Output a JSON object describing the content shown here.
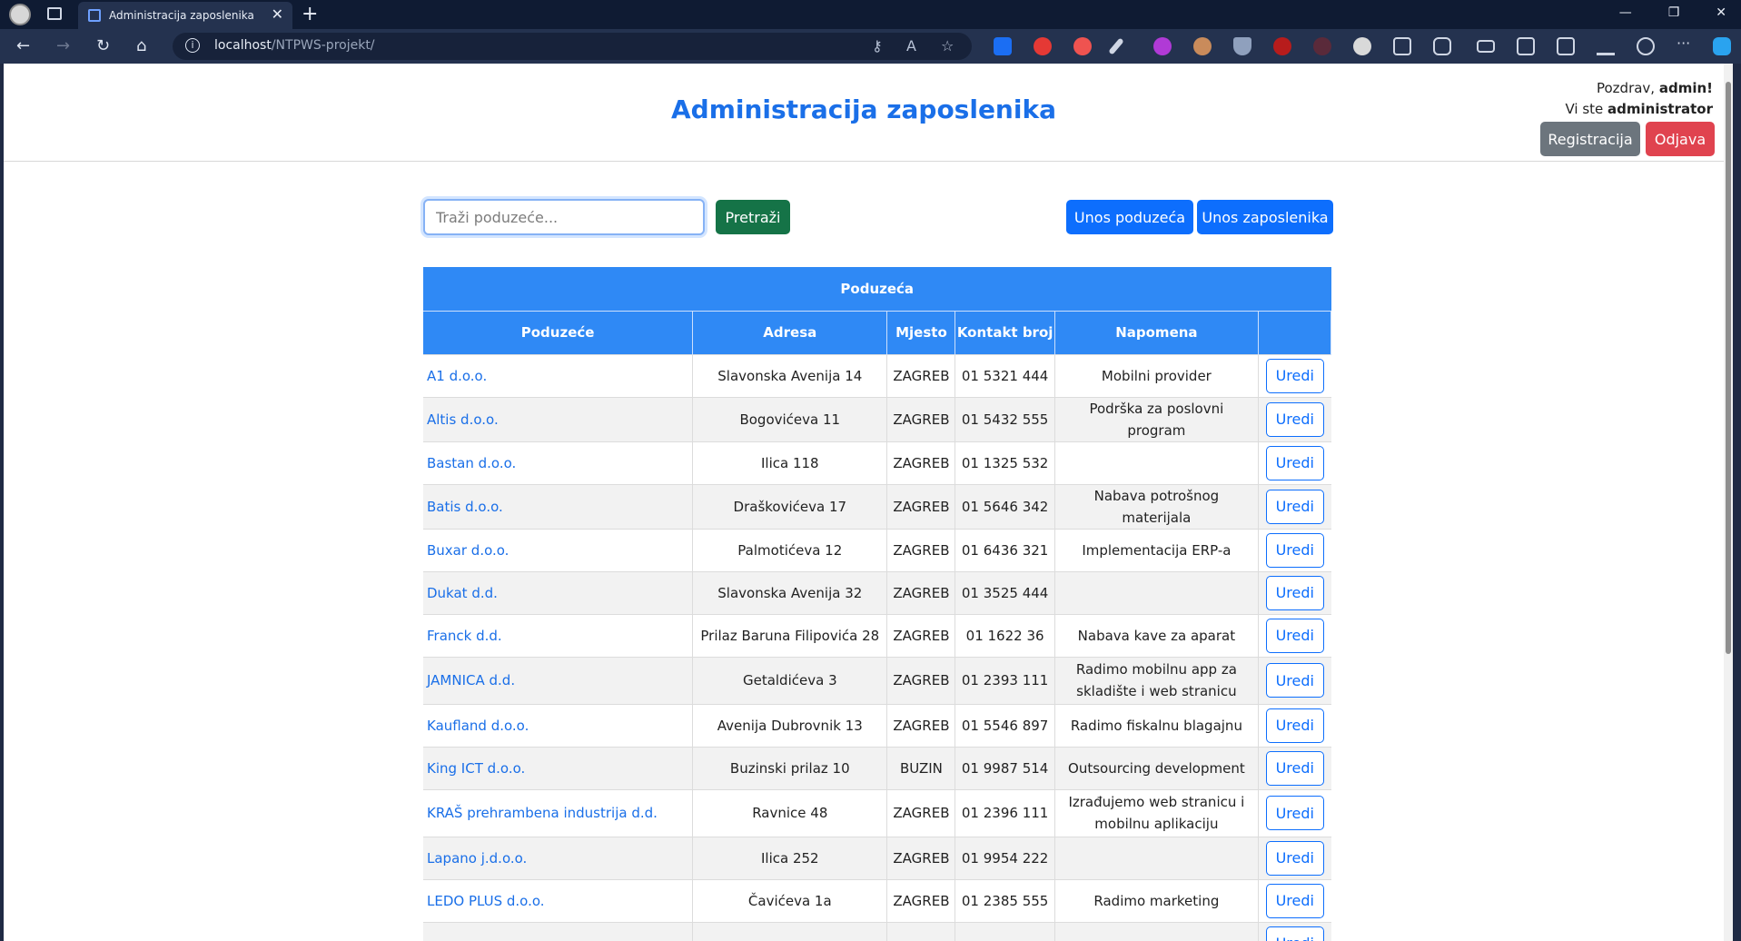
{
  "browser": {
    "tab_title": "Administracija zaposlenika",
    "tab_close": "✕",
    "new_tab": "+",
    "url_host": "localhost",
    "url_path": "/NTPWS-projekt/",
    "win_min": "—",
    "win_max": "❐",
    "win_close": "✕"
  },
  "header": {
    "title": "Administracija zaposlenika",
    "greeting_prefix": "Pozdrav, ",
    "username": "admin!",
    "role_prefix": "Vi ste ",
    "role": "administrator",
    "register_label": "Registracija",
    "logout_label": "Odjava"
  },
  "toolbar": {
    "search_placeholder": "Traži poduzeće...",
    "search_label": "Pretraži",
    "add_company_label": "Unos poduzeća",
    "add_employee_label": "Unos zaposlenika"
  },
  "table": {
    "caption": "Poduzeća",
    "columns": [
      "Poduzeće",
      "Adresa",
      "Mjesto",
      "Kontakt broj",
      "Napomena",
      ""
    ],
    "edit_label": "Uredi",
    "rows": [
      {
        "name": "A1 d.o.o.",
        "address": "Slavonska Avenija 14",
        "city": "ZAGREB",
        "phone": "01 5321 444",
        "note": "Mobilni provider"
      },
      {
        "name": "Altis d.o.o.",
        "address": "Bogovićeva 11",
        "city": "ZAGREB",
        "phone": "01 5432 555",
        "note": "Podrška za poslovni program"
      },
      {
        "name": "Bastan d.o.o.",
        "address": "Ilica 118",
        "city": "ZAGREB",
        "phone": "01 1325 532",
        "note": ""
      },
      {
        "name": "Batis d.o.o.",
        "address": "Draškovićeva 17",
        "city": "ZAGREB",
        "phone": "01 5646 342",
        "note": "Nabava potrošnog materijala"
      },
      {
        "name": "Buxar d.o.o.",
        "address": "Palmotićeva 12",
        "city": "ZAGREB",
        "phone": "01 6436 321",
        "note": "Implementacija ERP-a"
      },
      {
        "name": "Dukat d.d.",
        "address": "Slavonska Avenija 32",
        "city": "ZAGREB",
        "phone": "01 3525 444",
        "note": ""
      },
      {
        "name": "Franck d.d.",
        "address": "Prilaz Baruna Filipovića 28",
        "city": "ZAGREB",
        "phone": "01 1622 36",
        "note": "Nabava kave za aparat"
      },
      {
        "name": "JAMNICA d.d.",
        "address": "Getaldićeva 3",
        "city": "ZAGREB",
        "phone": "01 2393 111",
        "note": "Radimo mobilnu app za skladište i web stranicu"
      },
      {
        "name": "Kaufland d.o.o.",
        "address": "Avenija Dubrovnik 13",
        "city": "ZAGREB",
        "phone": "01 5546 897",
        "note": "Radimo fiskalnu blagajnu"
      },
      {
        "name": "King ICT d.o.o.",
        "address": "Buzinski prilaz 10",
        "city": "BUZIN",
        "phone": "01 9987 514",
        "note": "Outsourcing development"
      },
      {
        "name": "KRAŠ prehrambena industrija d.d.",
        "address": "Ravnice 48",
        "city": "ZAGREB",
        "phone": "01 2396 111",
        "note": "Izrađujemo web stranicu i mobilnu aplikaciju"
      },
      {
        "name": "Lapano j.d.o.o.",
        "address": "Ilica 252",
        "city": "ZAGREB",
        "phone": "01 9954 222",
        "note": ""
      },
      {
        "name": "LEDO PLUS d.o.o.",
        "address": "Čavićeva 1a",
        "city": "ZAGREB",
        "phone": "01 2385 555",
        "note": "Radimo marketing"
      },
      {
        "name": "",
        "address": "",
        "city": "",
        "phone": "",
        "note": ""
      }
    ]
  }
}
